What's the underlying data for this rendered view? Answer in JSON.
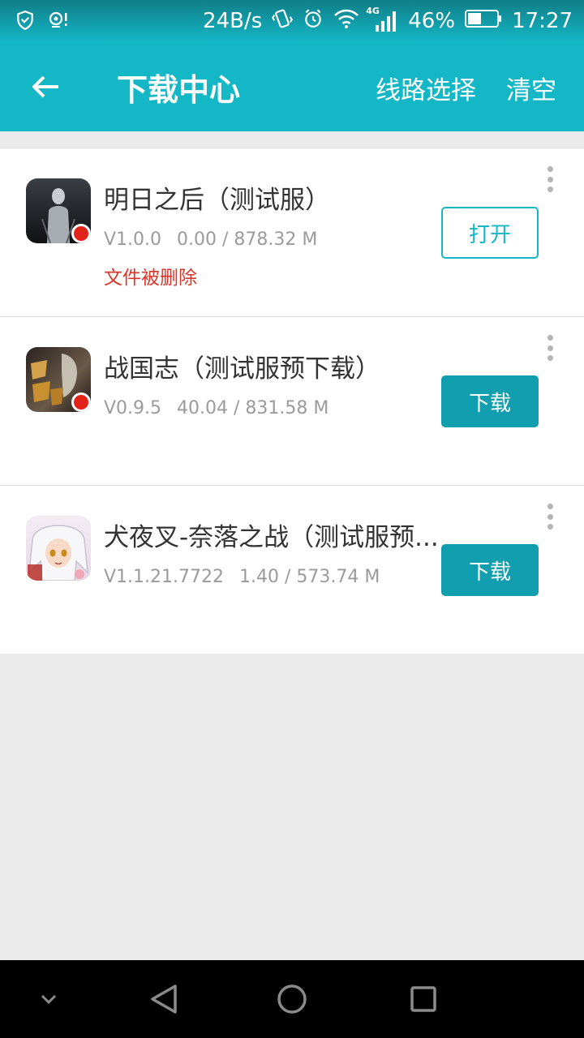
{
  "status_bar": {
    "speed": "24B/s",
    "network": "4G",
    "battery": "46%",
    "time": "17:27"
  },
  "app_bar": {
    "title": "下载中心",
    "route_select": "线路选择",
    "clear": "清空"
  },
  "downloads": [
    {
      "title": "明日之后（测试服）",
      "version": "V1.0.0",
      "progress": "0.00 / 878.32 M",
      "error": "文件被删除",
      "action": "打开",
      "icon": "mingri-game-icon"
    },
    {
      "title": "战国志（测试服预下载）",
      "version": "V0.9.5",
      "progress": "40.04 / 831.58 M",
      "action": "下载",
      "icon": "zhanguozhi-game-icon"
    },
    {
      "title": "犬夜叉-奈落之战（测试服预...",
      "version": "V1.1.21.7722",
      "progress": "1.40 / 573.74 M",
      "action": "下载",
      "icon": "inuyasha-game-icon"
    }
  ],
  "colors": {
    "primary": "#14b7c6",
    "button": "#119fb0",
    "error": "#d9362b"
  }
}
